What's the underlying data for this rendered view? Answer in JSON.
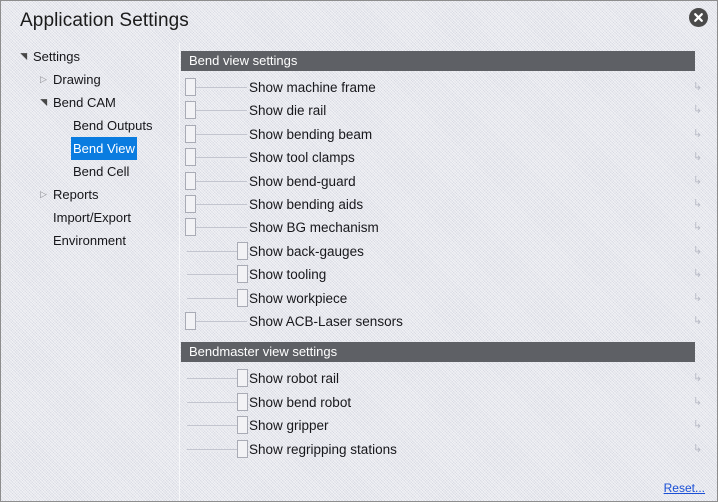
{
  "window": {
    "title": "Application Settings",
    "close_icon": "close-circle-icon"
  },
  "tree": {
    "items": [
      {
        "label": "Settings",
        "depth": 0,
        "twisty": "expanded",
        "selected": false
      },
      {
        "label": "Drawing",
        "depth": 1,
        "twisty": "collapsed",
        "selected": false
      },
      {
        "label": "Bend CAM",
        "depth": 1,
        "twisty": "expanded",
        "selected": false
      },
      {
        "label": "Bend Outputs",
        "depth": 2,
        "twisty": "none",
        "selected": false
      },
      {
        "label": "Bend View",
        "depth": 2,
        "twisty": "none",
        "selected": true
      },
      {
        "label": "Bend Cell",
        "depth": 2,
        "twisty": "none",
        "selected": false
      },
      {
        "label": "Reports",
        "depth": 1,
        "twisty": "collapsed",
        "selected": false
      },
      {
        "label": "Import/Export",
        "depth": 1,
        "twisty": "none",
        "selected": false
      },
      {
        "label": "Environment",
        "depth": 1,
        "twisty": "none",
        "selected": false
      }
    ]
  },
  "panel": {
    "sections": [
      {
        "title": "Bend view settings",
        "rows": [
          {
            "label": "Show machine frame",
            "state": "off",
            "reset_icon": "reset-arrow-icon"
          },
          {
            "label": "Show die rail",
            "state": "off",
            "reset_icon": "reset-arrow-icon"
          },
          {
            "label": "Show bending beam",
            "state": "off",
            "reset_icon": "reset-arrow-icon"
          },
          {
            "label": "Show tool clamps",
            "state": "off",
            "reset_icon": "reset-arrow-icon"
          },
          {
            "label": "Show bend-guard",
            "state": "off",
            "reset_icon": "reset-arrow-icon"
          },
          {
            "label": "Show bending aids",
            "state": "off",
            "reset_icon": "reset-arrow-icon"
          },
          {
            "label": "Show BG mechanism",
            "state": "off",
            "reset_icon": "reset-arrow-icon"
          },
          {
            "label": "Show back-gauges",
            "state": "on",
            "reset_icon": "reset-arrow-icon"
          },
          {
            "label": "Show tooling",
            "state": "on",
            "reset_icon": "reset-arrow-icon"
          },
          {
            "label": "Show workpiece",
            "state": "on",
            "reset_icon": "reset-arrow-icon"
          },
          {
            "label": "Show ACB-Laser sensors",
            "state": "off",
            "reset_icon": "reset-arrow-icon"
          }
        ]
      },
      {
        "title": "Bendmaster view settings",
        "rows": [
          {
            "label": "Show robot rail",
            "state": "on",
            "reset_icon": "reset-arrow-icon"
          },
          {
            "label": "Show bend robot",
            "state": "on",
            "reset_icon": "reset-arrow-icon"
          },
          {
            "label": "Show gripper",
            "state": "on",
            "reset_icon": "reset-arrow-icon"
          },
          {
            "label": "Show regripping stations",
            "state": "on",
            "reset_icon": "reset-arrow-icon"
          }
        ]
      }
    ]
  },
  "footer": {
    "reset_label": "Reset..."
  },
  "colors": {
    "selection": "#0a7ce0",
    "section_header_bg": "#5e6065",
    "link": "#1a4fd6",
    "background": "#d7d9e2"
  }
}
